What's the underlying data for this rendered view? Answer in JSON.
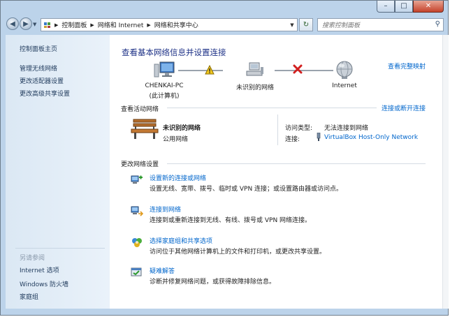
{
  "window": {
    "controls": {
      "minimize": "–",
      "maximize": "□",
      "close": "✕"
    }
  },
  "nav": {
    "back_icon": "back-arrow-icon",
    "forward_icon": "forward-arrow-icon",
    "breadcrumbs": [
      "控制面板",
      "网络和 Internet",
      "网络和共享中心"
    ],
    "search_placeholder": "搜索控制面板"
  },
  "sidebar": {
    "items": [
      "控制面板主页",
      "管理无线网络",
      "更改适配器设置",
      "更改高级共享设置"
    ],
    "see_also_label": "另请参阅",
    "see_also": [
      "Internet 选项",
      "Windows 防火墙",
      "家庭组"
    ]
  },
  "main": {
    "title": "查看基本网络信息并设置连接",
    "full_map_link": "查看完整映射",
    "map": {
      "computer": {
        "name": "CHENKAI-PC",
        "sub": "(此计算机)"
      },
      "network": {
        "name": "未识别的网络"
      },
      "internet": {
        "name": "Internet"
      }
    },
    "active": {
      "header": "查看活动网络",
      "connect_link": "连接或断开连接",
      "network_name": "未识别的网络",
      "network_type": "公用网络",
      "access_type_label": "访问类型:",
      "access_type_value": "无法连接到网络",
      "connections_label": "连接:",
      "connections_value": "VirtualBox Host-Only Network"
    },
    "change": {
      "header": "更改网络设置",
      "tasks": [
        {
          "title": "设置新的连接或网络",
          "desc": "设置无线、宽带、拨号、临时或 VPN 连接；或设置路由器或访问点。"
        },
        {
          "title": "连接到网络",
          "desc": "连接到或重新连接到无线、有线、拨号或 VPN 网络连接。"
        },
        {
          "title": "选择家庭组和共享选项",
          "desc": "访问位于其他网络计算机上的文件和打印机，或更改共享设置。"
        },
        {
          "title": "疑难解答",
          "desc": "诊断并修复网络问题，或获得故障排除信息。"
        }
      ]
    }
  }
}
